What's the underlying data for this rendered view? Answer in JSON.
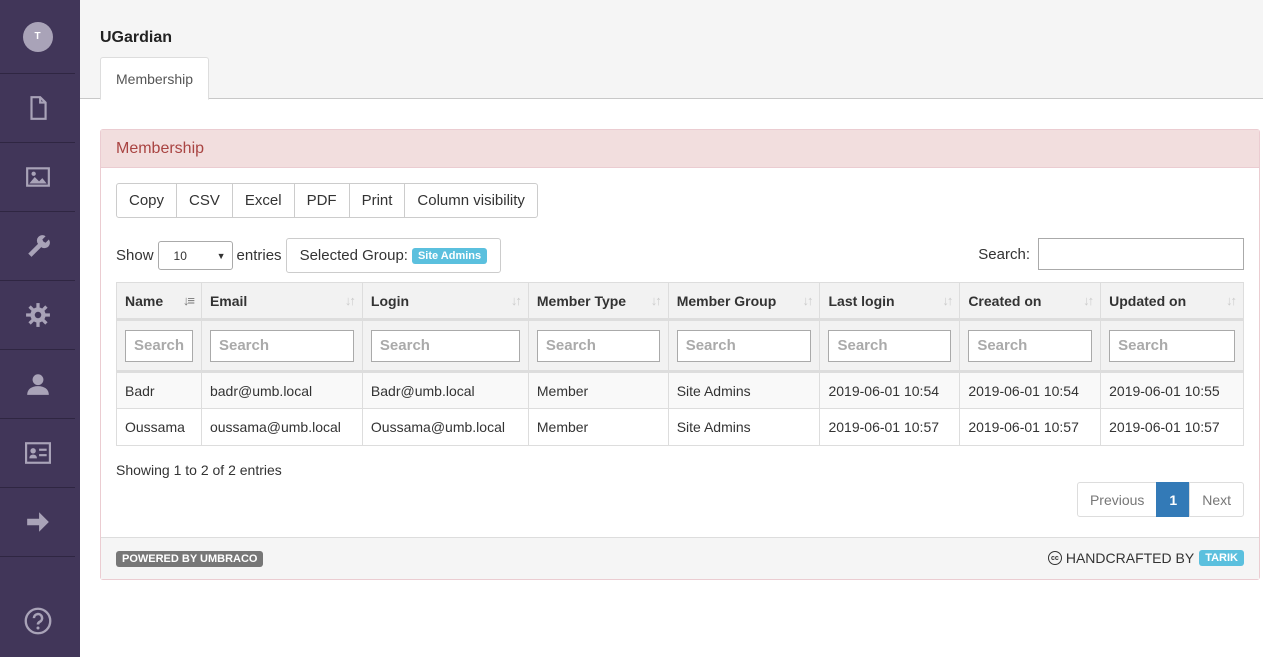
{
  "sidebar": {
    "avatar_initial": "T",
    "items": [
      {
        "name": "content",
        "icon": "document-icon"
      },
      {
        "name": "media",
        "icon": "image-icon"
      },
      {
        "name": "settings",
        "icon": "wrench-icon"
      },
      {
        "name": "developer",
        "icon": "gear-icon"
      },
      {
        "name": "users",
        "icon": "user-icon"
      },
      {
        "name": "members",
        "icon": "id-card-icon"
      },
      {
        "name": "forms",
        "icon": "arrow-right-icon"
      }
    ],
    "help_icon": "help-icon"
  },
  "header": {
    "title": "UGardian",
    "tab_label": "Membership"
  },
  "panel": {
    "title": "Membership",
    "buttons": [
      "Copy",
      "CSV",
      "Excel",
      "PDF",
      "Print",
      "Column visibility"
    ],
    "show_label": "Show",
    "entries_label": "entries",
    "page_length": "10",
    "selected_group_label": "Selected Group:",
    "selected_group_value": "Site Admins",
    "search_label": "Search:",
    "search_value": ""
  },
  "table": {
    "columns": [
      "Name",
      "Email",
      "Login",
      "Member Type",
      "Member Group",
      "Last login",
      "Created on",
      "Updated on"
    ],
    "filter_placeholder": "Search",
    "rows": [
      [
        "Badr",
        "badr@umb.local",
        "Badr@umb.local",
        "Member",
        "Site Admins",
        "2019-06-01 10:54",
        "2019-06-01 10:54",
        "2019-06-01 10:55"
      ],
      [
        "Oussama",
        "oussama@umb.local",
        "Oussama@umb.local",
        "Member",
        "Site Admins",
        "2019-06-01 10:57",
        "2019-06-01 10:57",
        "2019-06-01 10:57"
      ]
    ]
  },
  "info_text": "Showing 1 to 2 of 2 entries",
  "pagination": {
    "previous": "Previous",
    "current": "1",
    "next": "Next"
  },
  "footer": {
    "powered": "POWERED BY UMBRACO",
    "cc_symbol": "cc",
    "handcrafted": "HANDCRAFTED BY",
    "author": "TARIK"
  },
  "colors": {
    "sidebar_bg": "#413659",
    "panel_heading_bg": "#f2dede",
    "panel_heading_text": "#a94442",
    "info_badge": "#5bc0de",
    "pager_active": "#337ab7"
  }
}
